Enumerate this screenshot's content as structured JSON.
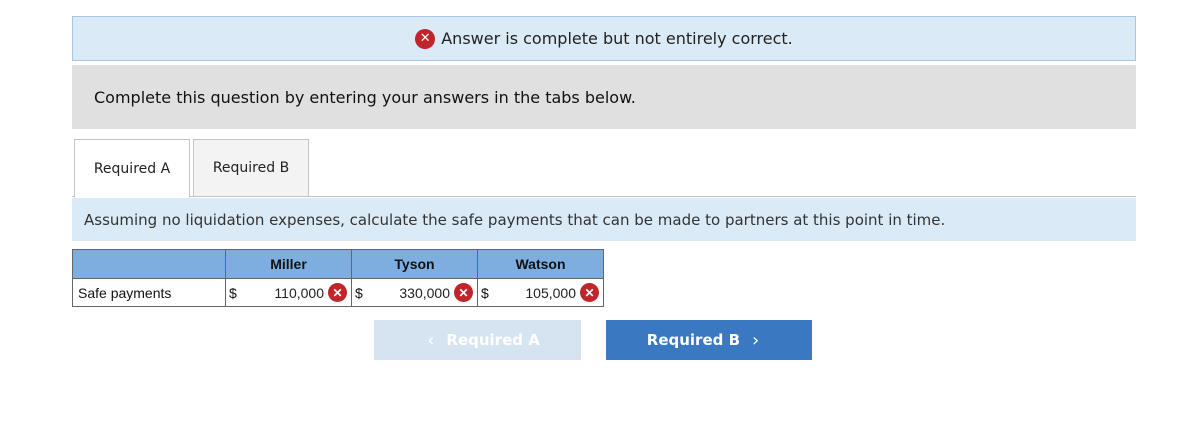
{
  "banner": {
    "icon": "error-x-icon",
    "message": "Answer is complete but not entirely correct."
  },
  "instructions": "Complete this question by entering your answers in the tabs below.",
  "tabs": [
    {
      "label": "Required A",
      "active": true
    },
    {
      "label": "Required B",
      "active": false
    }
  ],
  "question": "Assuming no liquidation expenses, calculate the safe payments that can be made to partners at this point in time.",
  "table": {
    "headers": [
      "",
      "Miller",
      "Tyson",
      "Watson"
    ],
    "row": {
      "label": "Safe payments",
      "cells": [
        {
          "currency": "$",
          "value": "110,000",
          "status": "incorrect"
        },
        {
          "currency": "$",
          "value": "330,000",
          "status": "incorrect"
        },
        {
          "currency": "$",
          "value": "105,000",
          "status": "incorrect"
        }
      ]
    }
  },
  "nav": {
    "prev_label": "Required A",
    "next_label": "Required B",
    "prev_enabled": false
  },
  "colors": {
    "error": "#c0252b",
    "banner_bg": "#daeaf7",
    "header_bg": "#7eaee0",
    "primary_button": "#3b78c2",
    "disabled_button": "#d6e4f2"
  }
}
